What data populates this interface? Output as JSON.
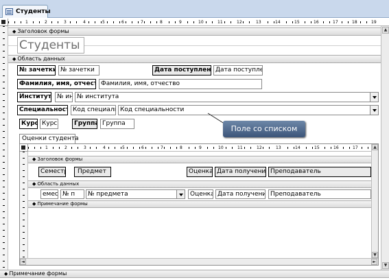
{
  "tab": {
    "label": "Студенты"
  },
  "sections": {
    "header": "Заголовок формы",
    "detail": "Область данных",
    "footer": "Примечание формы"
  },
  "form_title": "Студенты",
  "ruler_numbers": [
    "1",
    "2",
    "3",
    "4",
    "5",
    "6",
    "7",
    "8",
    "9",
    "10",
    "11",
    "12",
    "13",
    "14",
    "15",
    "16",
    "17",
    "18",
    "19"
  ],
  "fields": {
    "zachetka_label": "№ зачетки",
    "zachetka_value": "№ зачетки",
    "date_label": "Дата поступления",
    "date_value": "Дата поступлен",
    "fio_label": "Фамилия, имя, отчество",
    "fio_value": "Фамилия, имя, отчество",
    "institute_label": "Институт",
    "institute_num": "№ ин",
    "institute_combo": "№ института",
    "spec_label": "Специальность",
    "spec_code": "Код специаль",
    "spec_combo": "Код специальности",
    "course_label": "Курс",
    "course_value": "Курс",
    "group_label": "Группа",
    "group_value": "Группа"
  },
  "callout": "Поле со списком",
  "subform": {
    "tab_label": "Оценки студента",
    "ruler_numbers": [
      "1",
      "2",
      "3",
      "4",
      "5",
      "6",
      "7",
      "8",
      "9",
      "10",
      "11",
      "12",
      "13",
      "14",
      "15",
      "16",
      "17"
    ],
    "header_section": "Заголовок формы",
    "detail_section": "Область данных",
    "footer_section": "Примечание формы",
    "headers": {
      "semester": "Семестр",
      "subject": "Предмет",
      "grade": "Оценка",
      "date": "Дата получения",
      "teacher": "Преподаватель"
    },
    "row": {
      "semester": "емес",
      "num": "№ п",
      "subject_combo": "№ предмета",
      "grade": "Оценка",
      "date": "Дата получения",
      "teacher": "Преподаватель"
    }
  },
  "colors": {
    "callout": "#4e6a90",
    "tabstrip": "#c9d8ec"
  }
}
